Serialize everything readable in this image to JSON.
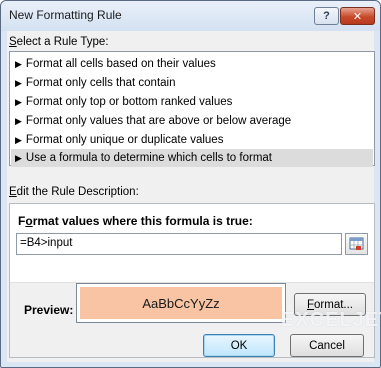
{
  "window": {
    "title": "New Formatting Rule",
    "help_label": "?",
    "close_label": "✕"
  },
  "rule_type": {
    "heading_prefix": "",
    "heading_u": "S",
    "heading_rest": "elect a Rule Type:",
    "items": [
      {
        "label": "Format all cells based on their values",
        "selected": false
      },
      {
        "label": "Format only cells that contain",
        "selected": false
      },
      {
        "label": "Format only top or bottom ranked values",
        "selected": false
      },
      {
        "label": "Format only values that are above or below average",
        "selected": false
      },
      {
        "label": "Format only unique or duplicate values",
        "selected": false
      },
      {
        "label": "Use a formula to determine which cells to format",
        "selected": true
      }
    ]
  },
  "description": {
    "heading_u": "E",
    "heading_rest": "dit the Rule Description:",
    "formula_heading_u": "o",
    "formula_heading_pre": "F",
    "formula_heading_rest": "rmat values where this formula is true:",
    "formula_value": "=B4>input",
    "preview_label": "Preview:",
    "preview_text": "AaBbCcYyZz",
    "preview_fill": "#f8c4a4",
    "format_button_pre": "",
    "format_button_u": "F",
    "format_button_rest": "ormat..."
  },
  "buttons": {
    "ok": "OK",
    "cancel": "Cancel"
  },
  "watermark": {
    "text": "EXCELJET"
  }
}
